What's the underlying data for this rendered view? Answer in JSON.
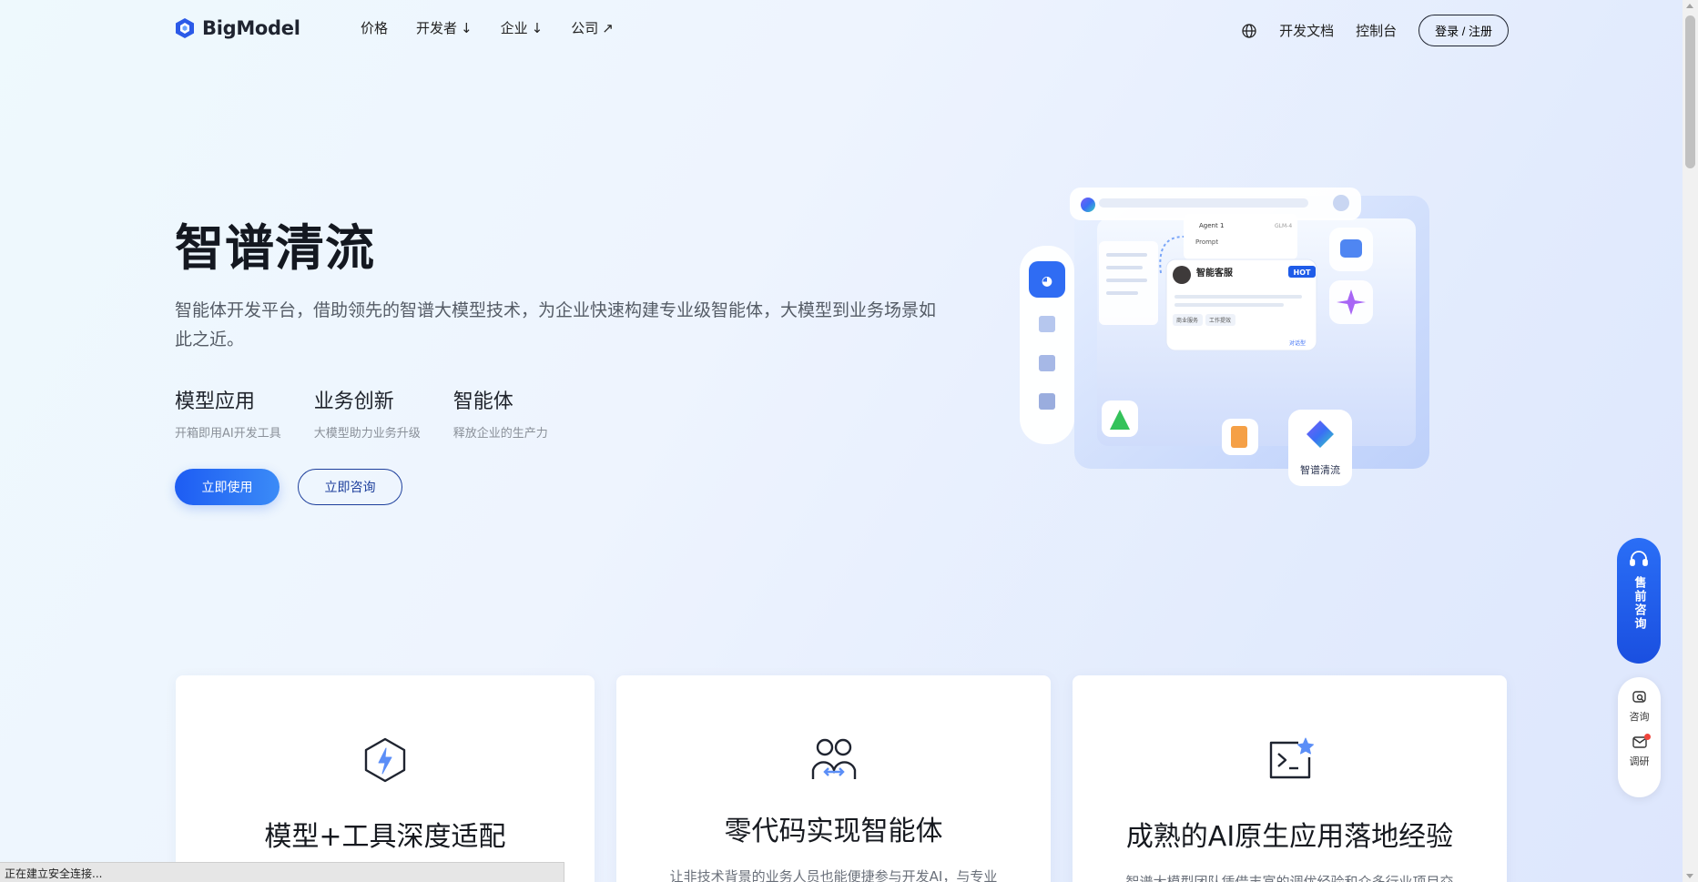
{
  "header": {
    "logo_text": "BigModel",
    "nav": [
      {
        "label": "价格",
        "suffix": ""
      },
      {
        "label": "开发者",
        "suffix": "↓"
      },
      {
        "label": "企业",
        "suffix": "↓"
      },
      {
        "label": "公司",
        "suffix": "↗"
      }
    ],
    "docs": "开发文档",
    "console": "控制台",
    "login": "登录 / 注册"
  },
  "hero": {
    "title": "智谱清流",
    "description": "智能体开发平台，借助领先的智谱大模型技术，为企业快速构建专业级智能体，大模型到业务场景如此之近。",
    "features": [
      {
        "title": "模型应用",
        "subtitle": "开箱即用AI开发工具"
      },
      {
        "title": "业务创新",
        "subtitle": "大模型助力业务升级"
      },
      {
        "title": "智能体",
        "subtitle": "释放企业的生产力"
      }
    ],
    "primary_button": "立即使用",
    "secondary_button": "立即咨询"
  },
  "illustration": {
    "agent_label": "Agent 1",
    "model_label": "GLM-4",
    "prompt_label": "Prompt",
    "service_title": "智能客服",
    "hot_badge": "HOT",
    "tag_1": "商业服务",
    "tag_2": "工作提效",
    "chat_link": "对话型",
    "brand_name": "智谱清流"
  },
  "floating": {
    "consult": "售前咨询",
    "ask": "咨询",
    "survey": "调研"
  },
  "cards": [
    {
      "title": "模型+工具深度适配",
      "text": ""
    },
    {
      "title": "零代码实现智能体",
      "text": "让非技术背景的业务人员也能便捷参与开发AI，与专业"
    },
    {
      "title": "成熟的AI原生应用落地经验",
      "text": "智谱大模型团队凭借丰富的调优经验和众多行业项目交"
    }
  ],
  "status_text": "正在建立安全连接...",
  "colors": {
    "primary": "#1d5cf3",
    "brand_dark": "#1f2430",
    "accent_purple": "#7b5cf7"
  }
}
